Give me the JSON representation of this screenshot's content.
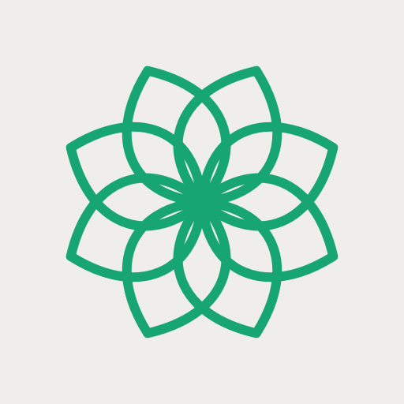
{
  "colors": {
    "background": "#F0EEEB",
    "logo_stroke": "#17A673"
  },
  "logo": {
    "icon": "lotus-rosette-icon",
    "petal_count": 8
  }
}
